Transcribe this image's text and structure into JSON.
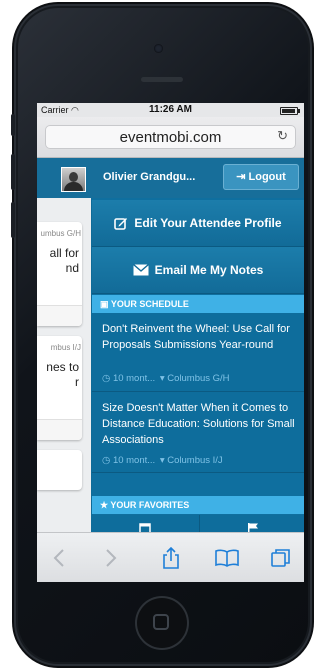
{
  "status_bar": {
    "carrier": "Carrier",
    "time": "11:26 AM"
  },
  "browser": {
    "domain": "eventmobi.com"
  },
  "user": {
    "name": "Olivier Grandgu...",
    "logout_label": "Logout"
  },
  "menu": {
    "edit_profile_label": "Edit Your Attendee Profile",
    "email_notes_label": "Email Me My Notes"
  },
  "schedule": {
    "header": "YOUR SCHEDULE",
    "items": [
      {
        "title": "Don't Reinvent the Wheel: Use Call for Proposals Submissions Year-round",
        "time": "10 mont...",
        "location": "Columbus G/H"
      },
      {
        "title": "Size Doesn't Matter When it Comes to Distance Education: Solutions for Small Associations",
        "time": "10 mont...",
        "location": "Columbus I/J"
      }
    ]
  },
  "favorites": {
    "header": "YOUR FAVORITES"
  },
  "background_cards": [
    {
      "location": "umbus G/H",
      "lines": [
        "all for",
        "nd"
      ]
    },
    {
      "location": "mbus I/J",
      "lines": [
        "nes to",
        "r"
      ]
    }
  ],
  "colors": {
    "accent_blue": "#0f6f9f",
    "section_header": "#3fb1e6",
    "meta_text": "#7fc2e6"
  }
}
